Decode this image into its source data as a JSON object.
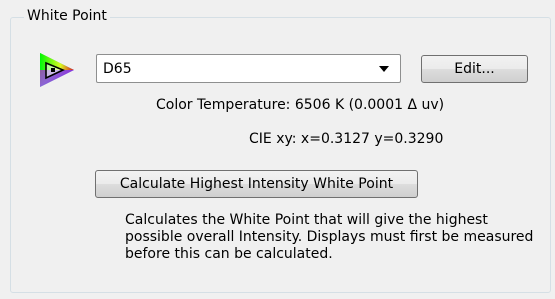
{
  "white_point": {
    "title": "White Point",
    "icon": "color-gamut-icon",
    "preset": {
      "selected": "D65"
    },
    "edit_label": "Edit...",
    "color_temperature_label": "Color Temperature:",
    "color_temperature_value": "6506 K (0.0001 Δ uv)",
    "cie_xy_label": "CIE xy:",
    "cie_xy_value": "x=0.3127 y=0.3290",
    "calculate_label": "Calculate Highest Intensity White Point",
    "description": "Calculates the White Point that will give the highest possible overall Intensity. Displays must first be measured before this can be calculated."
  }
}
